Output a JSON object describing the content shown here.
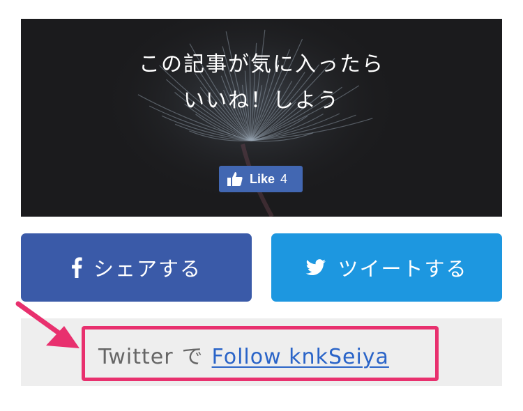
{
  "hero": {
    "title_line1": "この記事が気に入ったら",
    "title_line2": "いいね！しよう",
    "like_button": {
      "icon": "thumbs-up-icon",
      "label": "Like",
      "count": "4"
    }
  },
  "share": {
    "facebook": {
      "icon": "facebook-icon",
      "label": "シェアする"
    },
    "twitter": {
      "icon": "twitter-bird-icon",
      "label": "ツイートする"
    }
  },
  "follow": {
    "prefix": "Twitter",
    "particle": "で",
    "link_text": "Follow knkSeiya"
  },
  "annotation": {
    "color": "#e8306e"
  },
  "colors": {
    "facebook": "#3a5aa8",
    "twitter": "#1d97e0",
    "like_button": "#4267b2",
    "link": "#2a64c8"
  }
}
